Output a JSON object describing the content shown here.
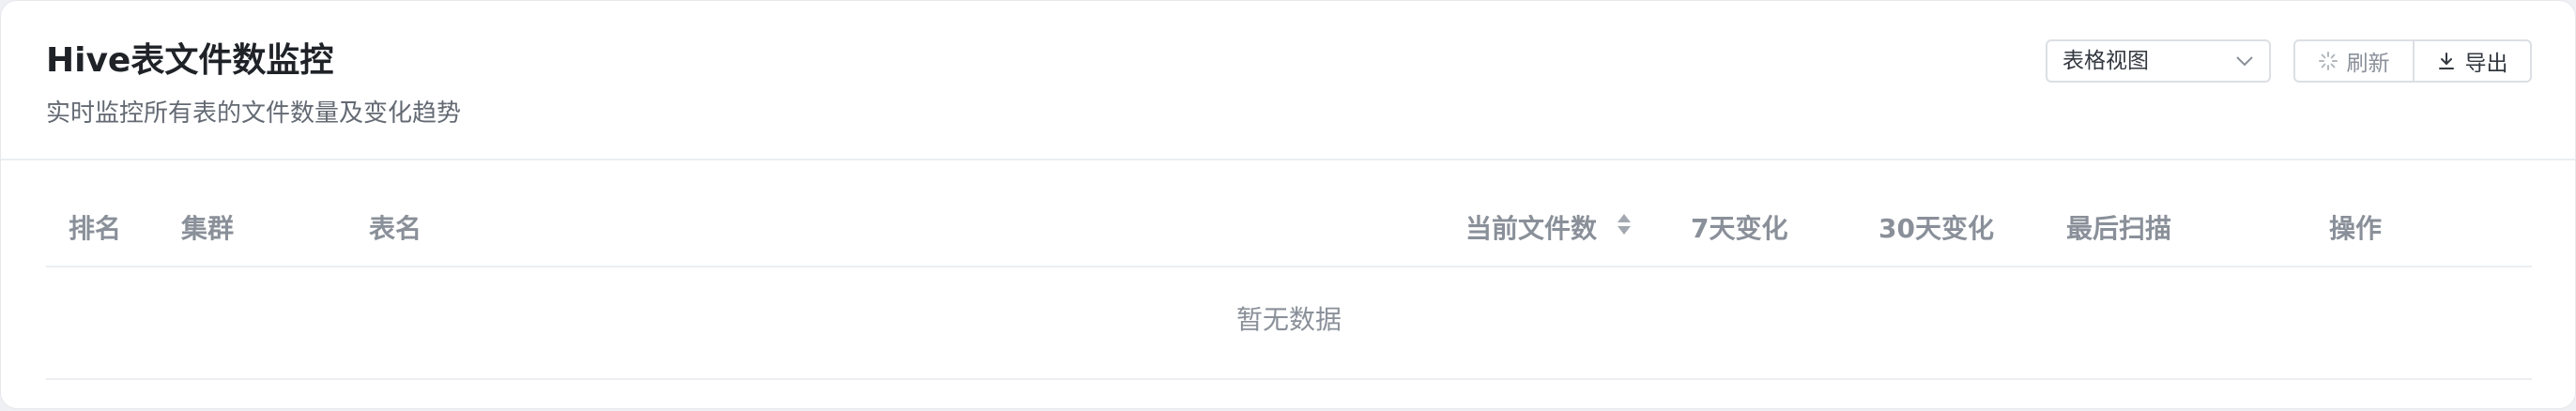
{
  "header": {
    "title": "Hive表文件数监控",
    "subtitle": "实时监控所有表的文件数量及变化趋势"
  },
  "toolbar": {
    "view_select": {
      "selected": "表格视图"
    },
    "refresh_label": "刷新",
    "export_label": "导出",
    "refresh_icon": "loading-spinner-icon",
    "export_icon": "download-icon"
  },
  "table": {
    "columns": [
      "排名",
      "集群",
      "表名",
      "当前文件数",
      "7天变化",
      "30天变化",
      "最后扫描",
      "操作"
    ],
    "sortable_column": "当前文件数",
    "rows": [],
    "empty_text": "暂无数据"
  },
  "colors": {
    "title": "#1f2328",
    "muted_text": "#8a9099",
    "subtitle": "#646a73",
    "border": "#dcdfe4",
    "divider": "#eceef1",
    "background": "#ffffff"
  }
}
